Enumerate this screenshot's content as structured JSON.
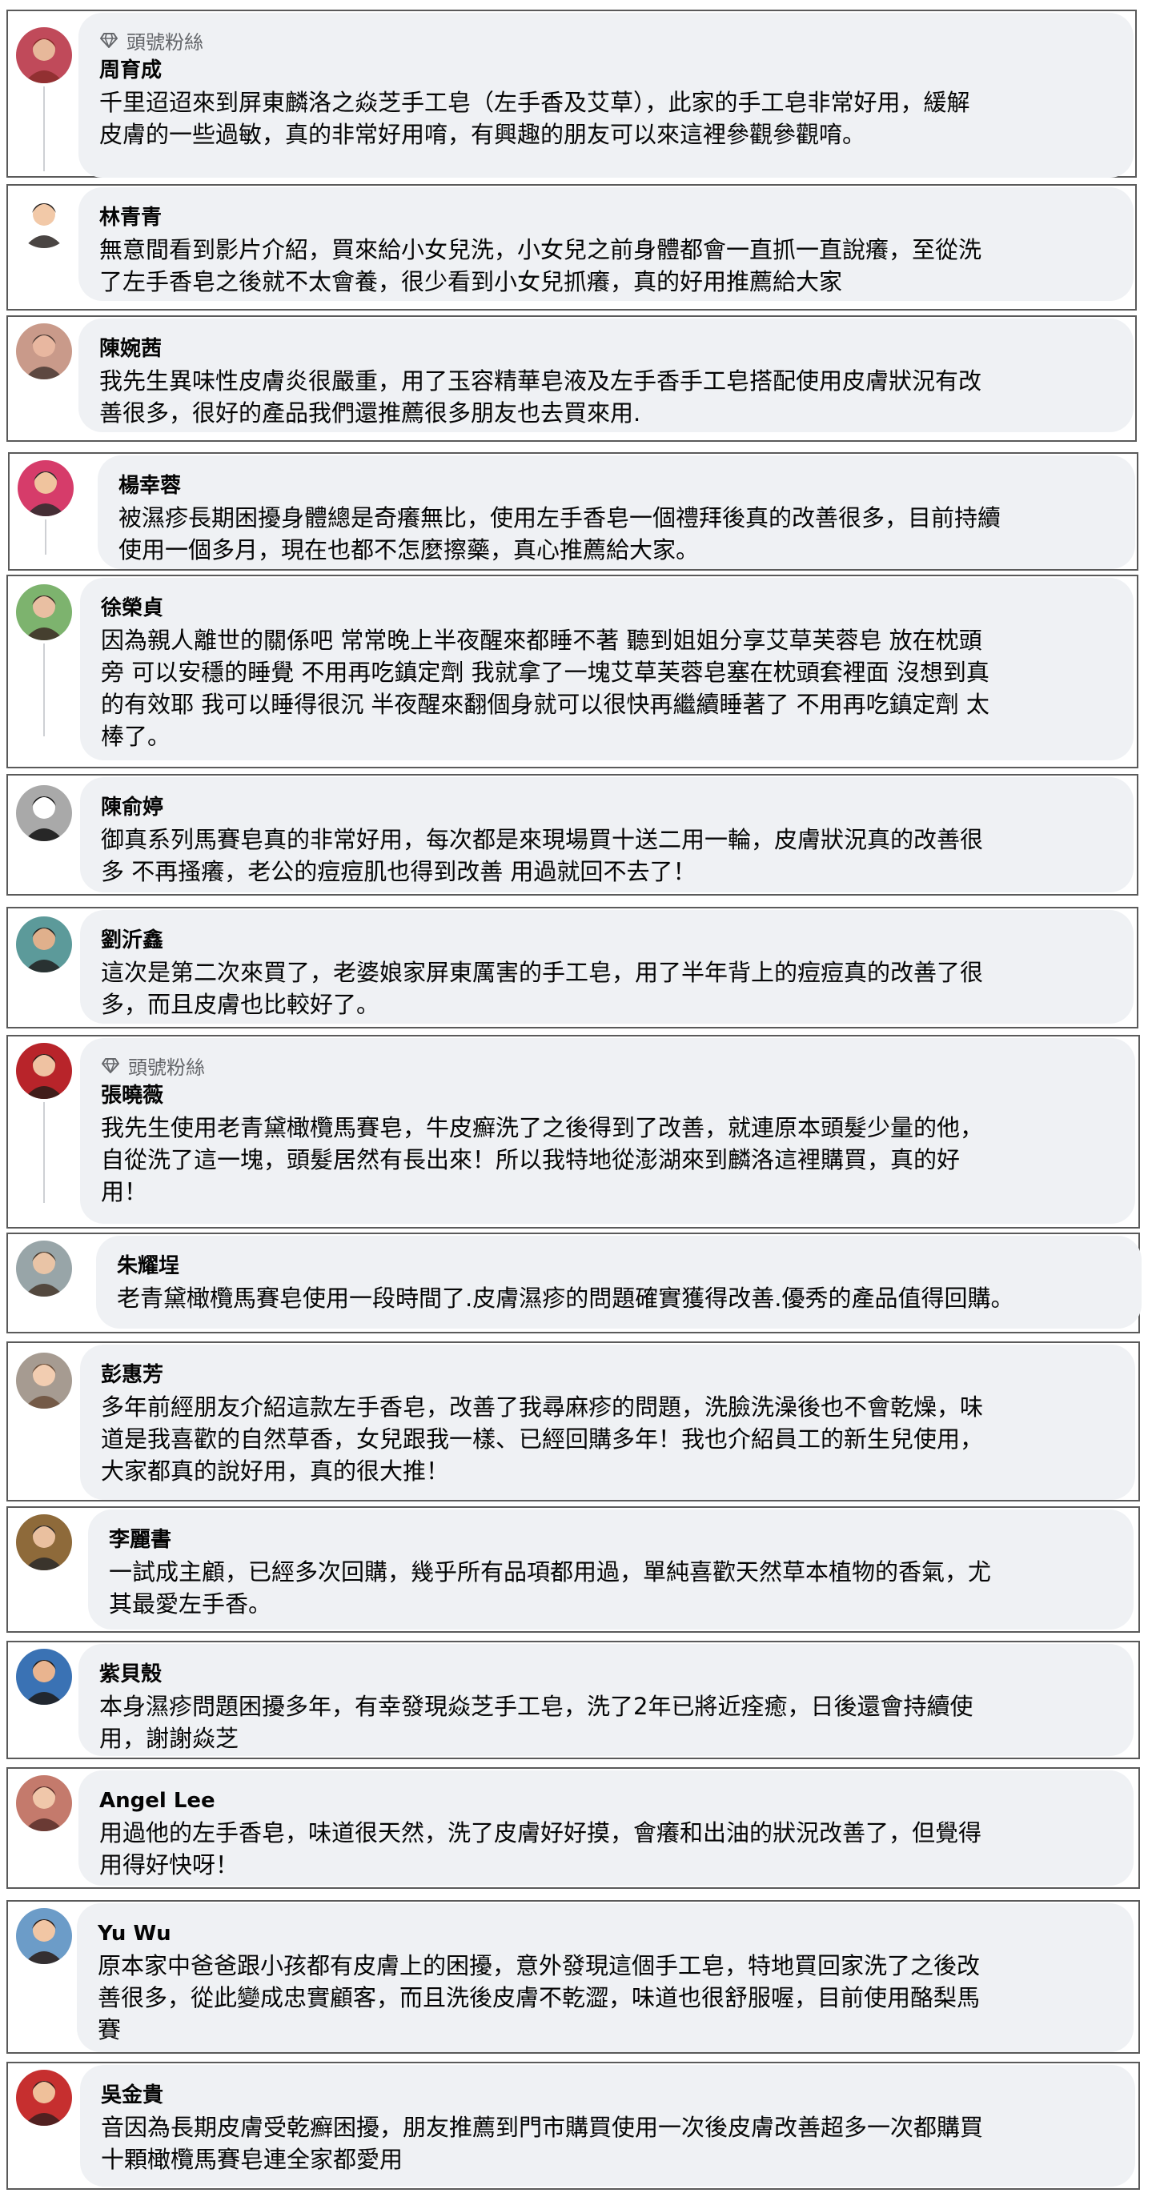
{
  "badge_label": "頭號粉絲",
  "badge_icon": "diamond-icon",
  "comments": [
    {
      "name": "周育成",
      "badge": true,
      "lines": [
        "千里迢迢來到屏東麟洛之焱芝手工皂（左手香及艾草），此家的手工皂非常好用，緩解",
        "皮膚的一些過敏，真的非常好用唷，有興趣的朋友可以來這裡參觀參觀唷。"
      ]
    },
    {
      "name": "林青青",
      "badge": false,
      "lines": [
        "無意間看到影片介紹，買來給小女兒洗，小女兒之前身體都會一直抓一直說癢，至從洗",
        "了左手香皂之後就不太會養，很少看到小女兒抓癢，真的好用推薦給大家"
      ]
    },
    {
      "name": "陳婉茜",
      "badge": false,
      "lines": [
        "我先生異味性皮膚炎很嚴重，用了玉容精華皂液及左手香手工皂搭配使用皮膚狀況有改",
        "善很多，很好的產品我們還推薦很多朋友也去買來用."
      ]
    },
    {
      "name": "楊幸蓉",
      "badge": false,
      "lines": [
        "被濕疹長期困擾身體總是奇癢無比，使用左手香皂一個禮拜後真的改善很多，目前持續",
        "使用一個多月，現在也都不怎麼擦藥，真心推薦給大家。"
      ]
    },
    {
      "name": "徐榮貞",
      "badge": false,
      "lines": [
        "因為親人離世的關係吧 常常晚上半夜醒來都睡不著 聽到姐姐分享艾草芙蓉皂 放在枕頭",
        "旁 可以安穩的睡覺 不用再吃鎮定劑 我就拿了一塊艾草芙蓉皂塞在枕頭套裡面 沒想到真",
        "的有效耶 我可以睡得很沉 半夜醒來翻個身就可以很快再繼續睡著了 不用再吃鎮定劑 太",
        "棒了。"
      ]
    },
    {
      "name": "陳俞婷",
      "badge": false,
      "lines": [
        "御真系列馬賽皂真的非常好用，每次都是來現場買十送二用一輪，皮膚狀況真的改善很",
        "多 不再搔癢，老公的痘痘肌也得到改善 用過就回不去了！"
      ]
    },
    {
      "name": "劉沂鑫",
      "badge": false,
      "lines": [
        "這次是第二次來買了，老婆娘家屏東厲害的手工皂，用了半年背上的痘痘真的改善了很",
        "多，而且皮膚也比較好了。"
      ]
    },
    {
      "name": "張曉薇",
      "badge": true,
      "lines": [
        "我先生使用老青黛橄欖馬賽皂，牛皮癬洗了之後得到了改善，就連原本頭髮少量的他，",
        "自從洗了這一塊，頭髮居然有長出來！所以我特地從澎湖來到麟洛這裡購買，真的好",
        "用！"
      ]
    },
    {
      "name": "朱耀埕",
      "badge": false,
      "lines": [
        "老青黛橄欖馬賽皂使用一段時間了.皮膚濕疹的問題確實獲得改善.優秀的產品值得回購。"
      ]
    },
    {
      "name": "彭惠芳",
      "badge": false,
      "lines": [
        "多年前經朋友介紹這款左手香皂，改善了我尋麻疹的問題，洗臉洗澡後也不會乾燥，味",
        "道是我喜歡的自然草香，女兒跟我一樣、已經回購多年！我也介紹員工的新生兒使用，",
        "大家都真的說好用，真的很大推！"
      ]
    },
    {
      "name": "李麗書",
      "badge": false,
      "lines": [
        "一試成主顧，已經多次回購，幾乎所有品項都用過，單純喜歡天然草本植物的香氣，尤",
        "其最愛左手香。"
      ]
    },
    {
      "name": "紫貝殼",
      "badge": false,
      "lines": [
        "本身濕疹問題困擾多年，有幸發現焱芝手工皂，洗了2年已將近痊癒，日後還會持續使",
        "用，謝謝焱芝"
      ]
    },
    {
      "name": "Angel Lee",
      "badge": false,
      "lines": [
        "用過他的左手香皂，味道很天然，洗了皮膚好好摸，會癢和出油的狀況改善了，但覺得",
        "用得好快呀！"
      ]
    },
    {
      "name": "Yu Wu",
      "badge": false,
      "lines": [
        "原本家中爸爸跟小孩都有皮膚上的困擾，意外發現這個手工皂，特地買回家洗了之後改",
        "善很多，從此變成忠實顧客，而且洗後皮膚不乾澀，味道也很舒服喔，目前使用酪梨馬",
        "賽"
      ]
    },
    {
      "name": "吳金貴",
      "badge": false,
      "lines": [
        "音因為長期皮膚受乾癬困擾，朋友推薦到門市購買使用一次後皮膚改善超多一次都購買",
        "十顆橄欖馬賽皂連全家都愛用"
      ]
    }
  ]
}
